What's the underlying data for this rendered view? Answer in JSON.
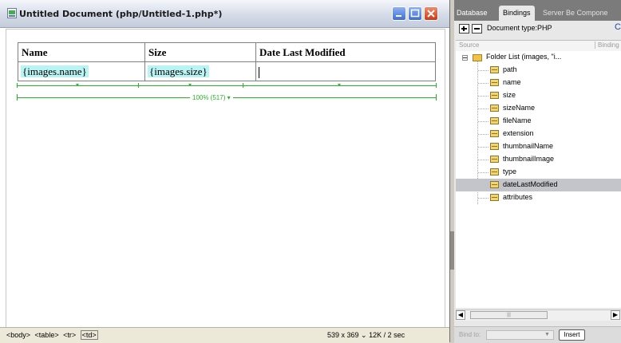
{
  "document_window": {
    "title": "Untitled Document (php/Untitled-1.php*)",
    "table": {
      "headers": [
        "Name",
        "Size",
        "Date Last Modified"
      ],
      "row": [
        "{images.name}",
        "{images.size}",
        ""
      ]
    },
    "width_label": "100% (517) ▾",
    "status": {
      "tags": [
        "<body>",
        "<table>",
        "<tr>",
        "<td>"
      ],
      "info": "539 x 369 ⌄ 12K / 2 sec"
    }
  },
  "panel": {
    "tabs": [
      "Database",
      "Bindings",
      "Server Be Compone"
    ],
    "document_type": "Document type:PHP",
    "columns": {
      "source": "Source",
      "binding": "Binding"
    },
    "tree": {
      "root": "Folder List (images, \"i...",
      "items": [
        "path",
        "name",
        "size",
        "sizeName",
        "fileName",
        "extension",
        "thumbnailName",
        "thumbnailImage",
        "type",
        "dateLastModified",
        "attributes"
      ],
      "selected": "dateLastModified"
    },
    "bind_to_label": "Bind to:",
    "insert_label": "Insert"
  },
  "colors": {
    "title_gradient_top": "#f4f6fb",
    "dynamic_text_bg": "#b9f3f3",
    "guide_green": "#27b327",
    "selected_row": "#c4c4cb"
  }
}
